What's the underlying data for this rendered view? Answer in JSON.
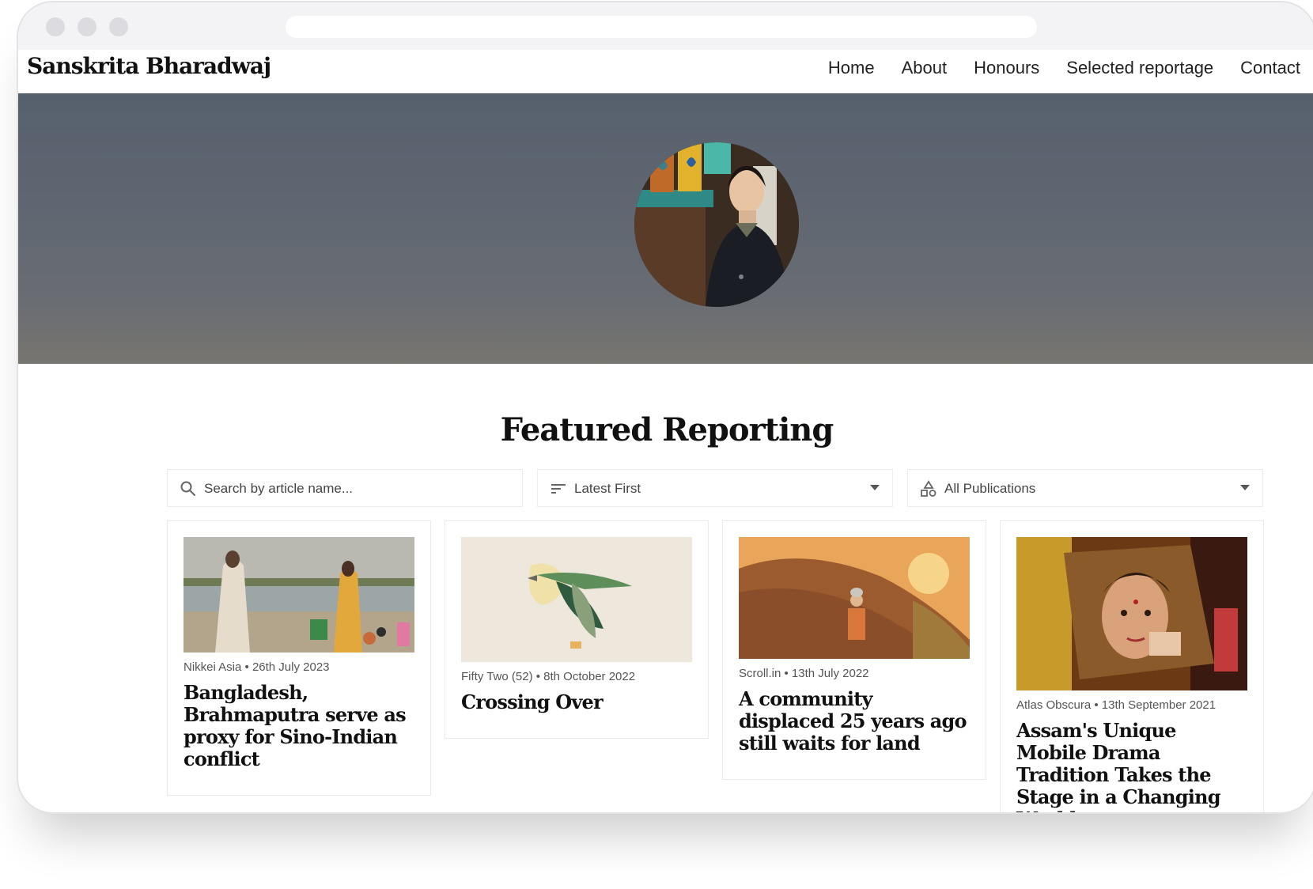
{
  "browser": {
    "url": ""
  },
  "site": {
    "brand": "Sanskrita Bharadwaj",
    "nav": [
      {
        "label": "Home"
      },
      {
        "label": "About"
      },
      {
        "label": "Honours"
      },
      {
        "label": "Selected reportage"
      },
      {
        "label": "Contact"
      }
    ]
  },
  "hero": {
    "avatar_alt": "portrait"
  },
  "featured": {
    "title": "Featured Reporting",
    "search": {
      "placeholder": "Search by article name...",
      "value": ""
    },
    "sort": {
      "selected": "Latest First"
    },
    "publication_filter": {
      "selected": "All Publications"
    },
    "articles": [
      {
        "publication": "Nikkei Asia",
        "date": "26th July 2023",
        "meta": "Nikkei Asia • 26th July 2023",
        "title": "Bangladesh, Brahmaputra serve as proxy for Sino-Indian conflict"
      },
      {
        "publication": "Fifty Two (52)",
        "date": "8th October 2022",
        "meta": "Fifty Two (52) • 8th October 2022",
        "title": "Crossing Over"
      },
      {
        "publication": "Scroll.in",
        "date": "13th July 2022",
        "meta": "Scroll.in • 13th July 2022",
        "title": "A community displaced 25 years ago still waits for land"
      },
      {
        "publication": "Atlas Obscura",
        "date": "13th September 2021",
        "meta": "Atlas Obscura • 13th September 2021",
        "title": "Assam's Unique Mobile Drama Tradition Takes the Stage in a Changing World"
      }
    ]
  },
  "icons": {
    "search": "search-icon",
    "sort": "sort-lines-icon",
    "publications": "shapes-icon",
    "dropdown": "chevron-down-icon"
  }
}
